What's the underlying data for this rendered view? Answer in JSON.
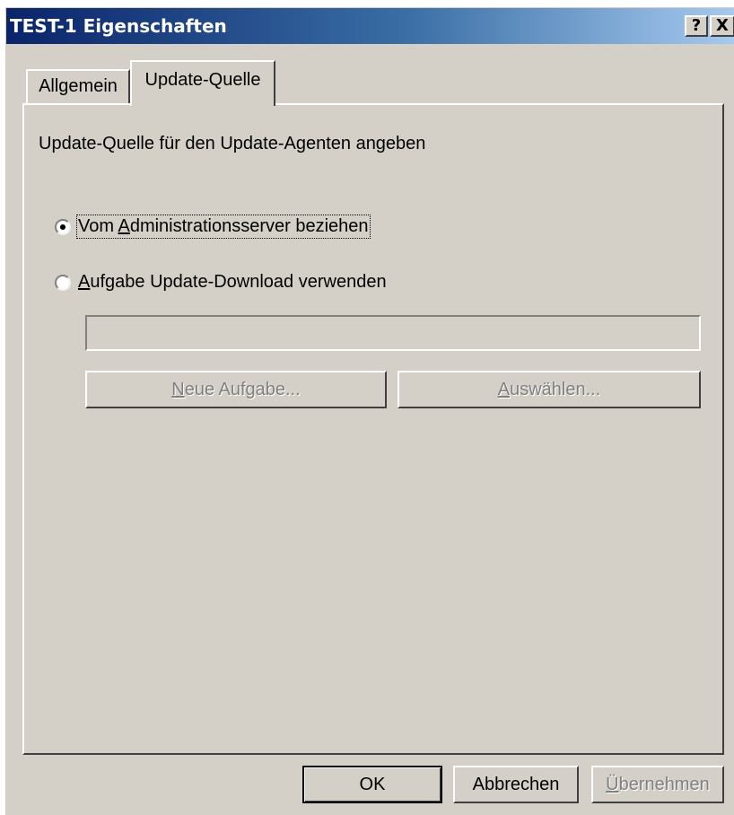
{
  "window": {
    "title": "TEST-1 Eigenschaften",
    "help_button": "?",
    "close_button": "X"
  },
  "tabs": [
    {
      "label": "Allgemein",
      "active": false
    },
    {
      "label": "Update-Quelle",
      "active": true
    }
  ],
  "panel": {
    "heading": "Update-Quelle für den Update-Agenten angeben",
    "options": [
      {
        "label": "Vom Administrationsserver beziehen",
        "accel_pre": "Vom ",
        "accel": "A",
        "accel_post": "dministrationsserver beziehen",
        "selected": true
      },
      {
        "label": "Aufgabe Update-Download verwenden",
        "accel_pre": "",
        "accel": "A",
        "accel_post": "ufgabe Update-Download verwenden",
        "selected": false
      }
    ],
    "task_field": {
      "value": "",
      "enabled": false
    },
    "new_task_button": {
      "label": "Neue Aufgabe...",
      "accel": "N",
      "rest": "eue Aufgabe...",
      "enabled": false
    },
    "select_button": {
      "label": "Auswählen...",
      "accel": "A",
      "rest": "uswählen...",
      "enabled": false
    }
  },
  "footer": {
    "ok": "OK",
    "cancel": "Abbrechen",
    "apply": "Übernehmen",
    "apply_accel": "Ü",
    "apply_rest": "bernehmen",
    "apply_enabled": false
  },
  "colors": {
    "dialog_face": "#d4d0c8",
    "title_start": "#0a246a",
    "title_end": "#a6caf0"
  }
}
